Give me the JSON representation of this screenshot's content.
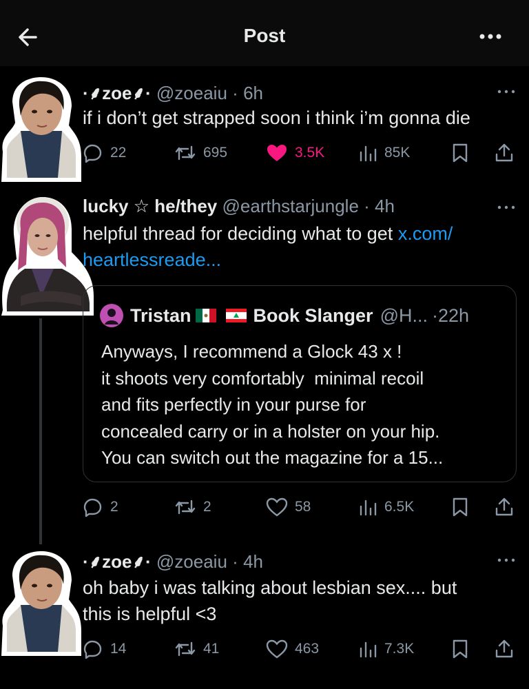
{
  "header": {
    "title": "Post"
  },
  "posts": [
    {
      "display_name": "·⸙zoe⸙·",
      "handle": "@zoeaiu",
      "time": "6h",
      "text": "if i don’t get strapped soon i think i’m gonna die",
      "replies": "22",
      "reposts": "695",
      "likes": "3.5K",
      "views": "85K"
    },
    {
      "display_name": "lucky ☆ he/they",
      "handle": "@earthstarjungle",
      "time": "4h",
      "text": "helpful thread for deciding what to get ",
      "link_line1": "x.com/",
      "link_line2": "heartlessreade...",
      "replies": "2",
      "reposts": "2",
      "likes": "58",
      "views": "6.5K",
      "quote": {
        "display_name_a": "Tristan",
        "display_name_b": "Book Slanger",
        "handle": "@H...",
        "time": "22h",
        "lines": [
          "Anyways, I recommend a Glock 43 x !",
          "it shoots very comfortably  minimal recoil",
          "and fits perfectly in your purse for",
          "concealed carry or in a holster on your hip.",
          "You can switch out the magazine for a 15..."
        ]
      }
    },
    {
      "display_name": "·⸙zoe⸙·",
      "handle": "@zoeaiu",
      "time": "4h",
      "text_line1": "oh baby i was talking about lesbian sex.... but",
      "text_line2": "this is helpful <3",
      "replies": "14",
      "reposts": "41",
      "likes": "463",
      "views": "7.3K"
    }
  ],
  "colors": {
    "accent_link": "#1d9bf0",
    "like_active": "#f91880",
    "muted": "#8b98a5"
  },
  "icons": [
    "back-arrow-icon",
    "more-icon",
    "reply-icon",
    "repost-icon",
    "heart-icon",
    "views-icon",
    "bookmark-icon",
    "share-icon"
  ]
}
